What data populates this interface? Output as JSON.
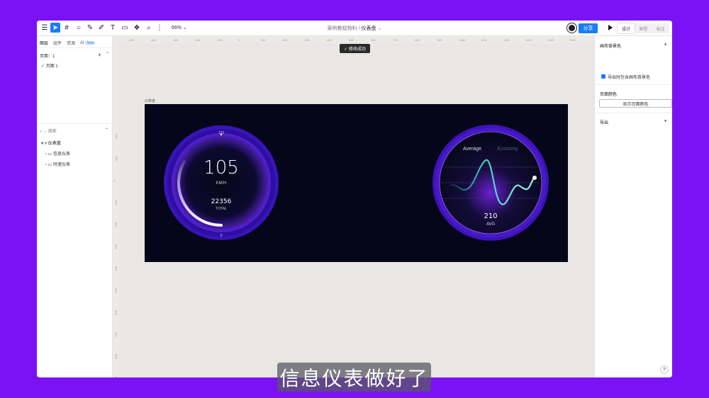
{
  "toolbar": {
    "zoom": "66%",
    "breadcrumb_project": "案例教程物料",
    "breadcrumb_sep": " / ",
    "breadcrumb_page": "仪表盘",
    "share": "分享",
    "modes": [
      "设计",
      "原型",
      "标注"
    ]
  },
  "left_panel": {
    "tabs": [
      "图层",
      "组件",
      "资源",
      "AI"
    ],
    "new_badge": "New",
    "pages_label": "页面：1",
    "page_1": "页面 1",
    "search_placeholder": "搜索",
    "layers": [
      "仪表盘",
      "信息仪表",
      "时速仪表"
    ]
  },
  "right_panel": {
    "canvas_bg": "画布背景色",
    "export_bg": "导出时包含画布背景色",
    "page_color": "页面颜色",
    "show_page_color": "显示页面颜色",
    "export": "导出"
  },
  "ruler_top": [
    "-500",
    "-400",
    "-300",
    "-200",
    "-100",
    "0",
    "100",
    "200",
    "300",
    "400",
    "500",
    "600",
    "700",
    "800",
    "900",
    "1000",
    "1100",
    "1200",
    "1300",
    "1400",
    "1500"
  ],
  "ruler_left": [
    "-200",
    "-100",
    "0",
    "100",
    "200",
    "300",
    "400",
    "500",
    "600",
    "700",
    "800",
    "900"
  ],
  "toast": "✓ 修改成功",
  "frame_label": "仪表盘",
  "speed_gauge": {
    "max": "120",
    "speed": "105",
    "unit": "KM/H",
    "total": "22356",
    "total_label": "TOTAL",
    "min": "0",
    "level": 0.875
  },
  "wave_gauge": {
    "tab_active": "Average",
    "tab_inactive": "Economy",
    "value": "210",
    "label": "AVG"
  },
  "subtitle": "信息仪表做好了",
  "colors": {
    "accent": "#1b7cf4",
    "purple": "#7a12f5",
    "teal": "#3fd0c0"
  }
}
